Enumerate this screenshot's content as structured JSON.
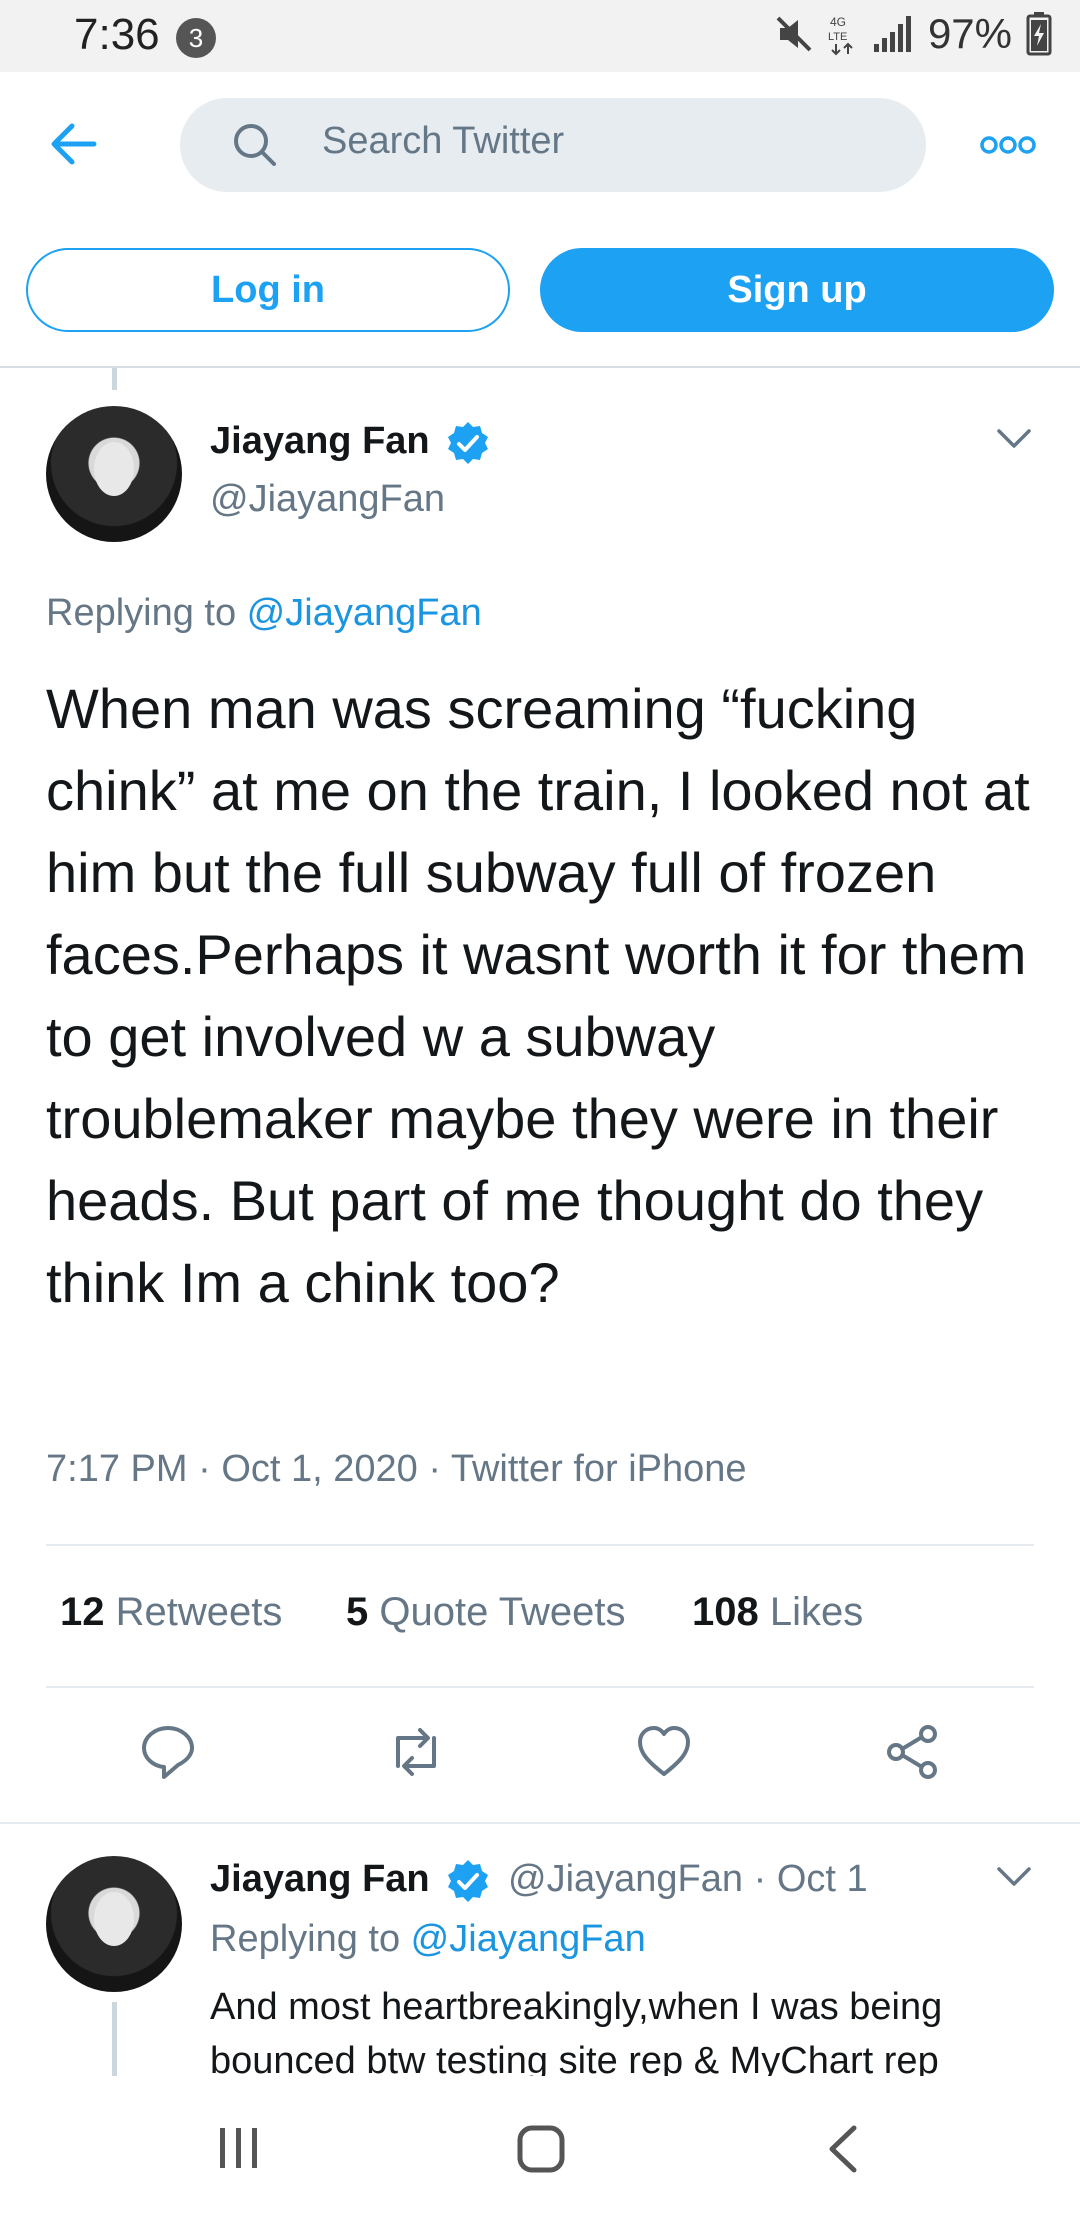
{
  "status_bar": {
    "time": "7:36",
    "notification_count": "3",
    "battery": "97%",
    "icons": [
      "mute-icon",
      "4g-icon",
      "signal-icon",
      "battery-charging-icon"
    ]
  },
  "header": {
    "search_placeholder": "Search Twitter",
    "icons": [
      "back-arrow-icon",
      "search-icon",
      "more-icon"
    ]
  },
  "auth": {
    "login_label": "Log in",
    "signup_label": "Sign up"
  },
  "tweet": {
    "author_name": "Jiayang Fan",
    "author_handle": "@JiayangFan",
    "replying_prefix": "Replying to ",
    "replying_to": "@JiayangFan",
    "text": "When man was screaming “fucking chink” at me on the train, I looked not at him but the full subway full of frozen faces.Perhaps it wasnt worth it for them to get involved w a subway troublemaker maybe they were in their heads. But part of me thought do they think Im a chink too?",
    "time": "7:17 PM",
    "date": "Oct 1, 2020",
    "source": "Twitter for iPhone",
    "sep": " · ",
    "retweets_count": "12",
    "retweets_label": " Retweets",
    "quote_count": "5",
    "quote_label": " Quote Tweets",
    "likes_count": "108",
    "likes_label": " Likes",
    "action_icons": [
      "reply-icon",
      "retweet-icon",
      "like-icon",
      "share-icon"
    ]
  },
  "reply": {
    "author_name": "Jiayang Fan",
    "author_handle": "@JiayangFan",
    "date": "Oct 1",
    "sep": " · ",
    "replying_prefix": "Replying to ",
    "replying_to": "@JiayangFan",
    "text": "And most heartbreakingly,when I was being bounced btw testing site rep & MyChart rep"
  },
  "nav_bar": {
    "icons": [
      "recent-apps-icon",
      "home-icon",
      "back-icon"
    ]
  },
  "colors": {
    "accent": "#1da1f2",
    "link": "#1b95e0",
    "secondary_text": "#657786",
    "search_bg": "#e6ecf0"
  }
}
